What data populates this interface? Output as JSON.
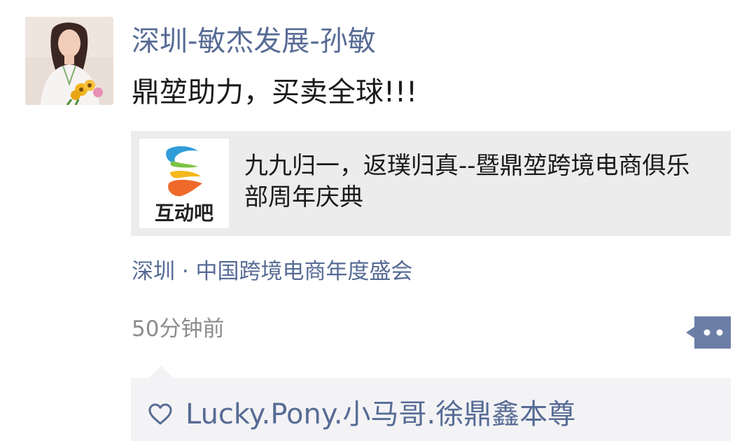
{
  "post": {
    "author_name": "深圳-敏杰发展-孙敏",
    "text": "鼎堃助力，买卖全球!!!",
    "shared_link": {
      "logo_text": "互动吧",
      "title": "九九归一，返璞归真--暨鼎堃跨境电商俱乐部周年庆典"
    },
    "location": "深圳 · 中国跨境电商年度盛会",
    "time": "50分钟前",
    "likes": {
      "names": "Lucky.Pony.小马哥.徐鼎鑫本尊"
    }
  },
  "icons": {
    "avatar": "profile-photo",
    "logo": "hands-logo-icon",
    "more": "more-dots-icon",
    "like": "heart-outline-icon"
  },
  "colors": {
    "link_blue": "#576b95",
    "card_bg": "#ececec",
    "like_panel_bg": "#f3f3f5",
    "more_button_bg": "#6d7ea6",
    "secondary_text": "#8c8c8c"
  }
}
